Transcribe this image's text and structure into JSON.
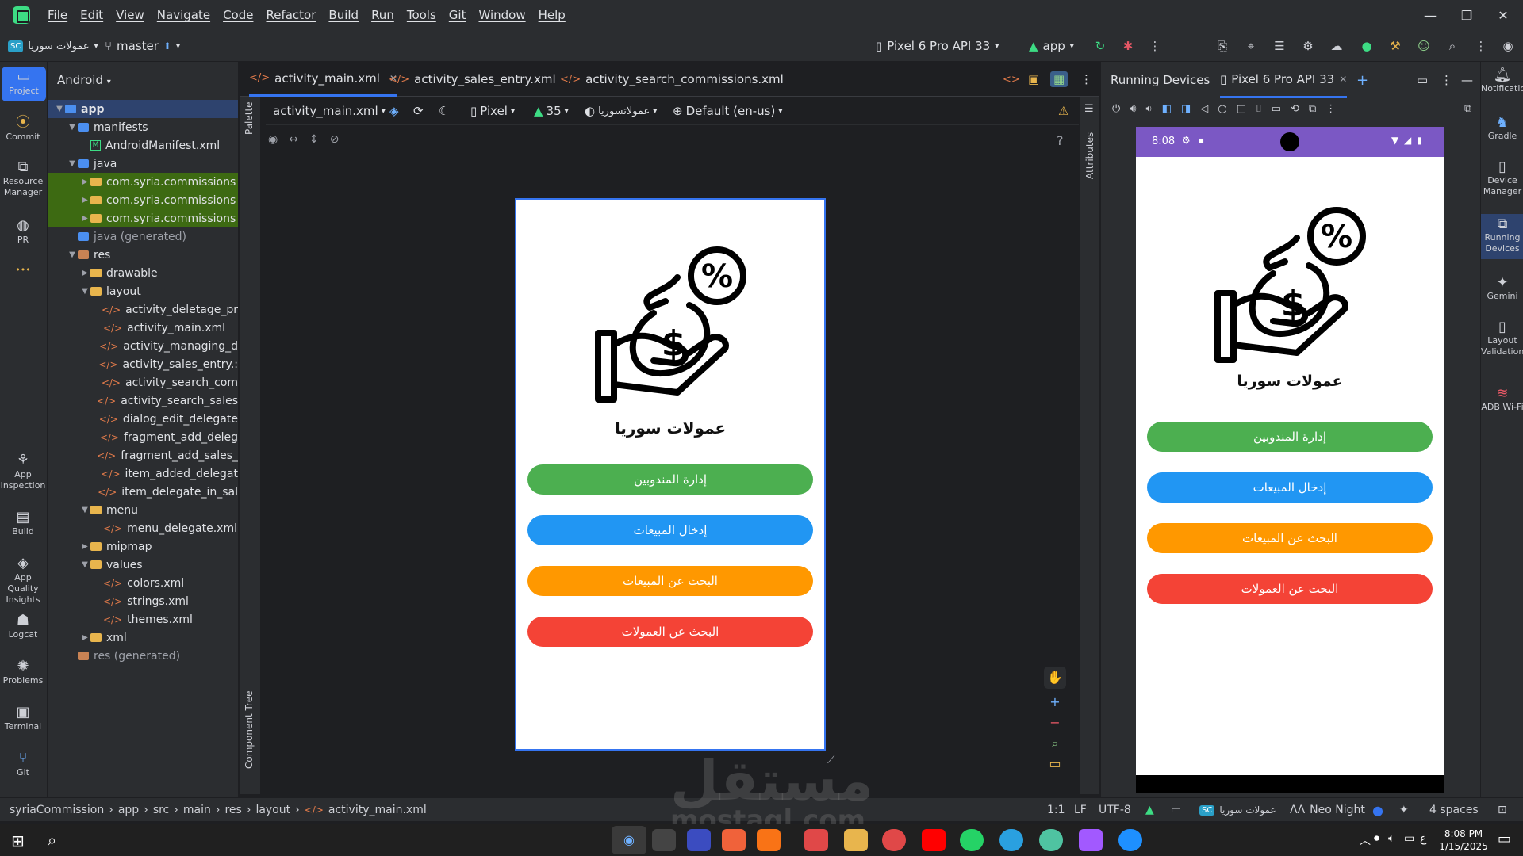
{
  "menu": [
    "File",
    "Edit",
    "View",
    "Navigate",
    "Code",
    "Refactor",
    "Build",
    "Run",
    "Tools",
    "Git",
    "Window",
    "Help"
  ],
  "toolbar": {
    "project_badge": "SC",
    "project_name": "عمولات سوريا",
    "branch": "master",
    "device": "Pixel 6 Pro API 33",
    "run_config": "app"
  },
  "left_strip": [
    "Project",
    "Commit",
    "Resource Manager",
    "PR",
    "App Inspection",
    "Build",
    "App Quality Insights",
    "Logcat",
    "Problems",
    "Terminal",
    "Git"
  ],
  "project_panel": {
    "view": "Android",
    "tree": [
      {
        "label": "app",
        "kind": "module"
      },
      {
        "label": "manifests",
        "kind": "folder-blue"
      },
      {
        "label": "AndroidManifest.xml",
        "kind": "manifest"
      },
      {
        "label": "java",
        "kind": "folder-blue"
      },
      {
        "label": "com.syria.commissions",
        "kind": "package"
      },
      {
        "label": "com.syria.commissions",
        "kind": "package"
      },
      {
        "label": "com.syria.commissions",
        "kind": "package"
      },
      {
        "label": "java (generated)",
        "kind": "folder-blue"
      },
      {
        "label": "res",
        "kind": "folder-res"
      },
      {
        "label": "drawable",
        "kind": "folder"
      },
      {
        "label": "layout",
        "kind": "folder"
      },
      {
        "label": "activity_deletage_pr",
        "kind": "xml"
      },
      {
        "label": "activity_main.xml",
        "kind": "xml"
      },
      {
        "label": "activity_managing_d",
        "kind": "xml"
      },
      {
        "label": "activity_sales_entry.:",
        "kind": "xml"
      },
      {
        "label": "activity_search_com",
        "kind": "xml"
      },
      {
        "label": "activity_search_sales",
        "kind": "xml"
      },
      {
        "label": "dialog_edit_delegate",
        "kind": "xml"
      },
      {
        "label": "fragment_add_deleg",
        "kind": "xml"
      },
      {
        "label": "fragment_add_sales_",
        "kind": "xml"
      },
      {
        "label": "item_added_delegat",
        "kind": "xml"
      },
      {
        "label": "item_delegate_in_sal",
        "kind": "xml"
      },
      {
        "label": "menu",
        "kind": "folder"
      },
      {
        "label": "menu_delegate.xml",
        "kind": "xml"
      },
      {
        "label": "mipmap",
        "kind": "folder"
      },
      {
        "label": "values",
        "kind": "folder"
      },
      {
        "label": "colors.xml",
        "kind": "xml"
      },
      {
        "label": "strings.xml",
        "kind": "xml"
      },
      {
        "label": "themes.xml",
        "kind": "xml"
      },
      {
        "label": "xml",
        "kind": "folder"
      },
      {
        "label": "res (generated)",
        "kind": "folder-res"
      }
    ]
  },
  "editor_tabs": [
    "activity_main.xml",
    "activity_sales_entry.xml",
    "activity_search_commissions.xml"
  ],
  "design_toolbar": {
    "file": "activity_main.xml",
    "device": "Pixel",
    "api": "35",
    "theme": "عمولاتسوريا",
    "locale": "Default (en-us)"
  },
  "side_labels": {
    "palette": "Palette",
    "attributes": "Attributes",
    "component_tree": "Component Tree"
  },
  "app_screen": {
    "title": "عمولات سوريا",
    "buttons": [
      {
        "label": "إدارة المندوبين",
        "color": "#4caf50"
      },
      {
        "label": "إدخال المبيعات",
        "color": "#2196f3"
      },
      {
        "label": "البحث عن المبيعات",
        "color": "#ff9800"
      },
      {
        "label": "البحث عن العمولات",
        "color": "#f44336"
      }
    ]
  },
  "right_panel": {
    "running_devices": "Running Devices",
    "device_tab": "Pixel 6 Pro API 33",
    "emu_time": "8:08"
  },
  "right_strip": [
    "Notifications",
    "Gradle",
    "Device Manager",
    "Running Devices",
    "Gemini",
    "Layout Validation",
    "ADB Wi-Fi"
  ],
  "statusbar": {
    "breadcrumb": [
      "syriaCommission",
      "app",
      "src",
      "main",
      "res",
      "layout",
      "activity_main.xml"
    ],
    "position": "1:1",
    "line_sep": "LF",
    "encoding": "UTF-8",
    "project_badge": "SC",
    "project_name": "عمولات سوريا",
    "theme": "Neo Night",
    "indent": "4 spaces"
  },
  "taskbar": {
    "time": "8:08 PM",
    "date": "1/15/2025",
    "lang": "ع"
  },
  "watermark": {
    "line1": "مستقل",
    "line2": "mostaql.com"
  }
}
